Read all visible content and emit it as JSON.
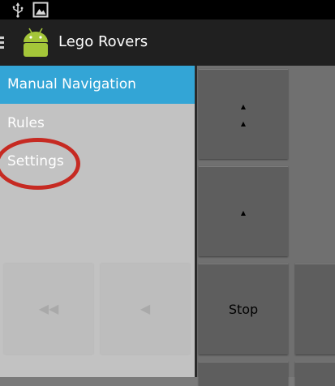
{
  "app": {
    "title": "Lego Rovers"
  },
  "status_bar": {
    "icons": [
      "usb-icon",
      "gallery-icon"
    ]
  },
  "nav": {
    "items": [
      {
        "label": "Manual Navigation",
        "active": true
      },
      {
        "label": "Rules",
        "active": false
      },
      {
        "label": "Settings",
        "active": false
      }
    ]
  },
  "remote": {
    "buttons": [
      {
        "id": "forward-fast",
        "glyphs": [
          "▲",
          "▲"
        ]
      },
      {
        "id": "forward",
        "glyphs": [
          "▲"
        ]
      },
      {
        "id": "stop",
        "label": "Stop"
      }
    ],
    "drawer_ghost_buttons": [
      {
        "id": "left-fast",
        "glyph": "◀◀"
      },
      {
        "id": "left",
        "glyph": "◀"
      }
    ]
  },
  "colors": {
    "accent": "#33a5d6",
    "action_bar": "#202020",
    "annotation_circle": "#c62a22"
  }
}
